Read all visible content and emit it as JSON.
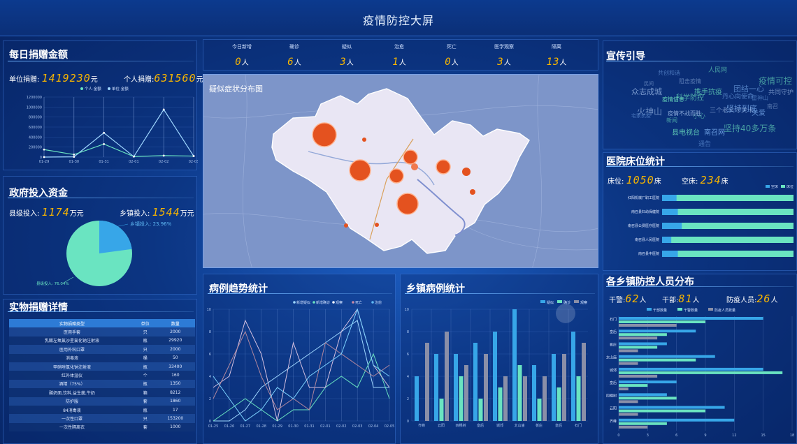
{
  "header": {
    "title": "疫情防控大屏"
  },
  "donation": {
    "title": "每日捐赠金额",
    "unit_label": "单位捐赠:",
    "unit_value": "1419230",
    "unit_suffix": "元",
    "person_label": "个人捐赠:",
    "person_value": "631560",
    "person_suffix": "元",
    "chart": {
      "legend": [
        "个人·金额",
        "单位·金额"
      ],
      "x": [
        "01-29",
        "01-30",
        "01-31",
        "02-01",
        "02-02",
        "02-03"
      ],
      "yticks": [
        "1200000",
        "1000000",
        "800000",
        "600000",
        "400000",
        "200000",
        "0"
      ]
    }
  },
  "gov": {
    "title": "政府投入资金",
    "county_label": "县级投入:",
    "county_value": "1174",
    "county_suffix": "万元",
    "town_label": "乡镇投入:",
    "town_value": "1544",
    "town_suffix": "万元",
    "slice_a": "乡镇投入: 23.96%",
    "slice_b": "县级投入: 76.04%"
  },
  "material": {
    "title": "实物捐赠详情",
    "headers": [
      "实物捐赠类型",
      "单位",
      "数量"
    ],
    "rows": [
      [
        "医用手套",
        "只",
        "2000"
      ],
      [
        "乳酸左氧氟沙星氯化钠注射液",
        "瓶",
        "29920"
      ],
      [
        "医用外科口罩",
        "只",
        "2000"
      ],
      [
        "消毒液",
        "桶",
        "50"
      ],
      [
        "甲硝唑氯化钠注射液",
        "瓶",
        "33400"
      ],
      [
        "红外体温仪",
        "个",
        "160"
      ],
      [
        "酒精（75%）",
        "瓶",
        "1350"
      ],
      [
        "酸奶面,饮料,益生菌,牛奶",
        "箱",
        "8212"
      ],
      [
        "防护服",
        "套",
        "1860"
      ],
      [
        "84消毒液",
        "瓶",
        "17"
      ],
      [
        "一次性口罩",
        "只",
        "153200"
      ],
      [
        "一次性隔离衣",
        "套",
        "1000"
      ]
    ]
  },
  "stats": [
    {
      "label": "今日新增",
      "value": "0",
      "unit": "人"
    },
    {
      "label": "确诊",
      "value": "6",
      "unit": "人"
    },
    {
      "label": "疑似",
      "value": "3",
      "unit": "人"
    },
    {
      "label": "治愈",
      "value": "1",
      "unit": "人"
    },
    {
      "label": "死亡",
      "value": "0",
      "unit": "人"
    },
    {
      "label": "医学观察",
      "value": "3",
      "unit": "人"
    },
    {
      "label": "隔离",
      "value": "13",
      "unit": "人"
    }
  ],
  "map": {
    "title": "疑似症状分布图"
  },
  "trend": {
    "title": "病例趋势统计",
    "legend": [
      "新增疑似",
      "新增确诊",
      "观察",
      "死亡",
      "治愈"
    ],
    "x": [
      "01-25",
      "01-26",
      "01-27",
      "01-28",
      "01-29",
      "01-30",
      "01-31",
      "02-01",
      "02-02",
      "02-03",
      "02-04",
      "02-05"
    ],
    "yticks": [
      "10",
      "8",
      "6",
      "4",
      "2",
      "0"
    ]
  },
  "township": {
    "title": "乡镇病例统计",
    "legend": [
      "疑似",
      "确诊",
      "观察"
    ],
    "x": [
      "齐峰",
      "云阳",
      "四棵树",
      "皇后",
      "城郊",
      "太山庙",
      "板庄",
      "皇后",
      "石门"
    ],
    "yticks": [
      "10",
      "8",
      "6",
      "4",
      "2",
      "0"
    ]
  },
  "publicity": {
    "title": "宣传引导",
    "words": [
      "人民网",
      "共创和谐",
      "阻击疫情",
      "携手抗疫",
      "团结一心",
      "众志成城",
      "科学防控",
      "丹心向使命",
      "火神山",
      "疫情可控",
      "坚持到底",
      "三个老头守关卡",
      "疫情信息",
      "关爱",
      "南召",
      "小心",
      "宅家抗疫",
      "共同守护",
      "新闻",
      "雷神山",
      "疫情不战而胜",
      "县电视台",
      "南召网",
      "民间",
      "坚持40多万条",
      "通告"
    ]
  },
  "beds": {
    "title": "医院床位统计",
    "bed_label": "床位:",
    "bed_value": "1050",
    "bed_unit": "床",
    "empty_label": "空床:",
    "empty_value": "234",
    "empty_unit": "床",
    "legend": [
      "空床",
      "床位"
    ],
    "hospitals": [
      "红阳机械厂职工医院",
      "南召县妇幼保健院",
      "南召县公费医疗医院",
      "南召县人民医院",
      "南召县中医院"
    ]
  },
  "staff": {
    "title": "各乡镇防控人员分布",
    "police_label": "干警:",
    "police_value": "62",
    "police_unit": "人",
    "cadre_label": "干部:",
    "cadre_value": "81",
    "cadre_unit": "人",
    "epid_label": "防疫人员:",
    "epid_value": "26",
    "epid_unit": "人",
    "legend": [
      "干部数量",
      "干警数量",
      "防疫人员数量"
    ],
    "towns": [
      "石门",
      "皇后",
      "板庄",
      "太山庙",
      "城郊",
      "皇后",
      "四棵树",
      "云阳",
      "齐峰"
    ],
    "xticks": [
      "0",
      "3",
      "6",
      "9",
      "12",
      "15",
      "18"
    ]
  },
  "colors": {
    "accent": "#f7b500",
    "cyan": "#37b7e8",
    "green": "#6ae4c1",
    "grey": "#8a8fa8"
  }
}
